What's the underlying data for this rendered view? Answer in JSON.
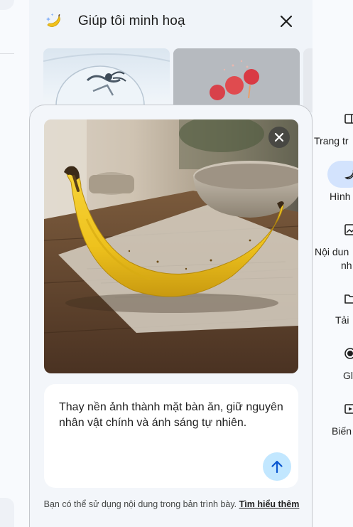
{
  "panel": {
    "title": "Giúp tôi minh hoạ",
    "close_label": "Đóng"
  },
  "prompt": {
    "text": "Thay nền ảnh thành mặt bàn ăn, giữ nguyên nhân vật chính và ánh sáng tự nhiên."
  },
  "disclaimer": {
    "text": "Bạn có thể sử dụng nội dung trong bản trình bày.",
    "link": "Tìm hiểu thêm"
  },
  "rail": {
    "items": [
      {
        "label_lines": [
          "Trang tr"
        ],
        "icon": "layout-icon"
      },
      {
        "label_lines": [
          "Hình"
        ],
        "icon": "banana-icon"
      },
      {
        "label_lines": [
          "Nội dun",
          "nh"
        ],
        "icon": "image-edit-icon"
      },
      {
        "label_lines": [
          "Tải"
        ],
        "icon": "folder-icon"
      },
      {
        "label_lines": [
          "Gl"
        ],
        "icon": "record-icon"
      },
      {
        "label_lines": [
          "Biến"
        ],
        "icon": "video-icon"
      }
    ],
    "selected_index": 1
  },
  "colors": {
    "panel_bg": "#f0f4f9",
    "accent_pill": "#d3e3fd",
    "send_button": "#c2e7ff",
    "banana_yellow": "#f2c21b"
  }
}
